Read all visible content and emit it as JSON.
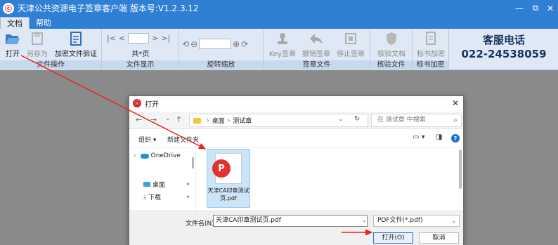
{
  "app": {
    "logo": "ⓒ",
    "title": "天津公共资源电子签章客户端  版本号:V1.2.3.12"
  },
  "window_controls": {
    "minimize": "—",
    "restore": "⧉",
    "close": "✕"
  },
  "menu": [
    {
      "label": "文档",
      "active": true
    },
    {
      "label": "帮助",
      "active": false
    }
  ],
  "ribbon": {
    "groups": {
      "file_ops": "文件操作",
      "file_display": "文件显示",
      "rotate_zoom": "旋转缩放",
      "sign_doc": "签章文件",
      "verify_doc": "核验文件",
      "encrypt_doc": "标书加密"
    },
    "buttons": {
      "open": "打开",
      "save_as": "另存为",
      "encrypt_verify": "加密文件验证",
      "key_sign": "Key签章",
      "revoke_sign": "撤销签章",
      "stop_sign": "停止签章",
      "verify": "核验文档",
      "tender_encrypt": "标书加密"
    },
    "page_nav": {
      "first": "|<",
      "prev": "<",
      "next": ">",
      "last": ">|",
      "page_value": "",
      "page_total": "共*页"
    },
    "zoom": {
      "value": ""
    },
    "service": {
      "title": "客服电话",
      "phone": "022-24538059"
    }
  },
  "dialog": {
    "title": "打开",
    "close": "✕",
    "nav": {
      "back": "←",
      "forward": "→",
      "dropdown": "⌄",
      "up": "↑"
    },
    "breadcrumb": [
      "桌面",
      "测试章"
    ],
    "breadcrumb_sep": "›",
    "search_placeholder": "在 测试章 中搜索",
    "toolbar": {
      "organize": "组织 ▾",
      "new_folder": "新建文件夹"
    },
    "sidebar": [
      {
        "label": "OneDrive",
        "chevron": "›"
      },
      {
        "label": "桌面",
        "pin": "📌"
      },
      {
        "label": "下载",
        "pin": "📌"
      }
    ],
    "file": {
      "name": "天津CA印章测试页.pdf",
      "badge": "P"
    },
    "filename_label": "文件名(N):",
    "filename_value": "天津CA印章测试页.pdf",
    "filetype": "PDF文件(*.pdf)",
    "open_button": "打开(O)",
    "cancel_button": "取消"
  },
  "colors": {
    "titlebar": "#2f7fd4",
    "ribbon": "#dfe9f5",
    "accent_arrow": "#e8251f",
    "pdf_red": "#e1302f"
  }
}
